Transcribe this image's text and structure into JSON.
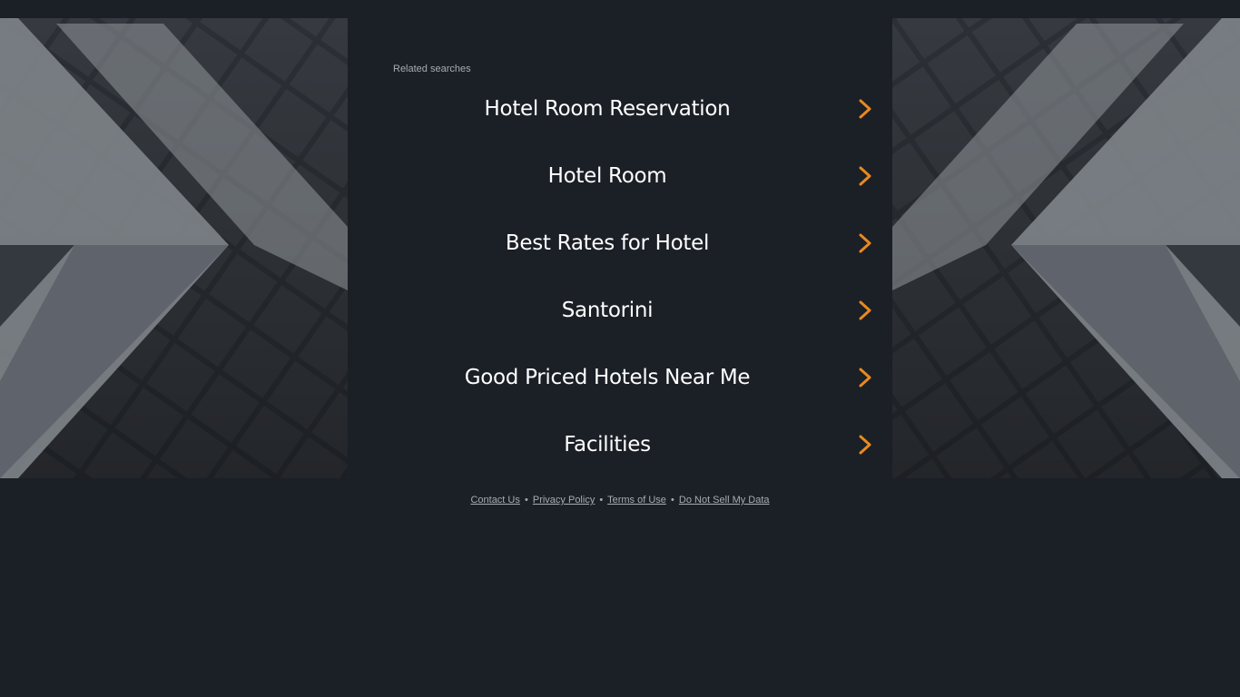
{
  "related": {
    "label": "Related searches",
    "items": [
      {
        "label": "Hotel Room Reservation"
      },
      {
        "label": "Hotel Room"
      },
      {
        "label": "Best Rates for Hotel"
      },
      {
        "label": "Santorini"
      },
      {
        "label": "Good Priced Hotels Near Me"
      },
      {
        "label": "Facilities"
      }
    ]
  },
  "footer": {
    "contact": "Contact Us",
    "privacy": "Privacy Policy",
    "terms": "Terms of Use",
    "do_not_sell": "Do Not Sell My Data",
    "separator": "•"
  },
  "colors": {
    "background": "#1b1f26",
    "accent_chevron": "#e8891f",
    "link_text": "#ffffff",
    "muted_text": "#a7abb2"
  },
  "icons": {
    "result_arrow": "chevron-right-icon"
  }
}
